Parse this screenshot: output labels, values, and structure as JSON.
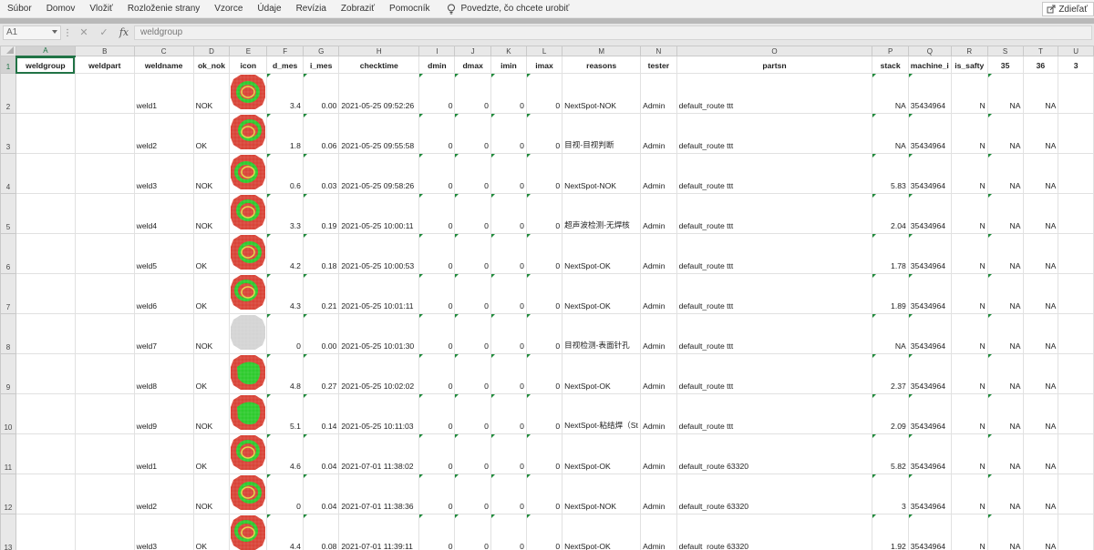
{
  "menu": {
    "items": [
      "Súbor",
      "Domov",
      "Vložiť",
      "Rozloženie strany",
      "Vzorce",
      "Údaje",
      "Revízia",
      "Zobraziť",
      "Pomocník"
    ],
    "tell_me": "Povedzte, čo chcete urobiť",
    "share": "Zdieľať"
  },
  "formula_bar": {
    "name_box": "A1",
    "separator": "⋮",
    "cancel": "✕",
    "enter": "✓",
    "fx": "fx",
    "content": "weldgroup"
  },
  "sheet": {
    "columns": [
      "A",
      "B",
      "C",
      "D",
      "E",
      "F",
      "G",
      "H",
      "I",
      "J",
      "K",
      "L",
      "M",
      "N",
      "O",
      "P",
      "Q",
      "R",
      "S",
      "T",
      "U"
    ],
    "headers": [
      "weldgroup",
      "weldpart",
      "weldname",
      "ok_nok",
      "icon",
      "d_mes",
      "i_mes",
      "checktime",
      "dmin",
      "dmax",
      "imin",
      "imax",
      "reasons",
      "tester",
      "partsn",
      "stack",
      "machine_i",
      "is_safty",
      "35",
      "36",
      "3"
    ],
    "rows": [
      {
        "rownum": "1"
      },
      {
        "rownum": "2",
        "weldname": "weld1",
        "ok_nok": "NOK",
        "icon": "weld-ring",
        "d_mes": "3.4",
        "i_mes": "0.00",
        "checktime": "2021-05-25 09:52:26",
        "dmin": "0",
        "dmax": "0",
        "imin": "0",
        "imax": "0",
        "reasons": "NextSpot-NOK",
        "tester": "Admin",
        "partsn": "default_route ttt",
        "stack": "NA",
        "machine_i": "35434964",
        "is_safty": "N",
        "c35": "NA",
        "c36": "NA"
      },
      {
        "rownum": "3",
        "weldname": "weld2",
        "ok_nok": "OK",
        "icon": "weld-ring",
        "d_mes": "1.8",
        "i_mes": "0.06",
        "checktime": "2021-05-25 09:55:58",
        "dmin": "0",
        "dmax": "0",
        "imin": "0",
        "imax": "0",
        "reasons": "目视-目视判断",
        "tester": "Admin",
        "partsn": "default_route ttt",
        "stack": "NA",
        "machine_i": "35434964",
        "is_safty": "N",
        "c35": "NA",
        "c36": "NA"
      },
      {
        "rownum": "4",
        "weldname": "weld3",
        "ok_nok": "NOK",
        "icon": "weld-ring",
        "d_mes": "0.6",
        "i_mes": "0.03",
        "checktime": "2021-05-25 09:58:26",
        "dmin": "0",
        "dmax": "0",
        "imin": "0",
        "imax": "0",
        "reasons": "NextSpot-NOK",
        "tester": "Admin",
        "partsn": "default_route ttt",
        "stack": "5.83",
        "machine_i": "35434964",
        "is_safty": "N",
        "c35": "NA",
        "c36": "NA"
      },
      {
        "rownum": "5",
        "weldname": "weld4",
        "ok_nok": "NOK",
        "icon": "weld-ring",
        "d_mes": "3.3",
        "i_mes": "0.19",
        "checktime": "2021-05-25 10:00:11",
        "dmin": "0",
        "dmax": "0",
        "imin": "0",
        "imax": "0",
        "reasons": "超声波检测-无焊核",
        "tester": "Admin",
        "partsn": "default_route ttt",
        "stack": "2.04",
        "machine_i": "35434964",
        "is_safty": "N",
        "c35": "NA",
        "c36": "NA"
      },
      {
        "rownum": "6",
        "weldname": "weld5",
        "ok_nok": "OK",
        "icon": "weld-ring",
        "d_mes": "4.2",
        "i_mes": "0.18",
        "checktime": "2021-05-25 10:00:53",
        "dmin": "0",
        "dmax": "0",
        "imin": "0",
        "imax": "0",
        "reasons": "NextSpot-OK",
        "tester": "Admin",
        "partsn": "default_route ttt",
        "stack": "1.78",
        "machine_i": "35434964",
        "is_safty": "N",
        "c35": "NA",
        "c36": "NA"
      },
      {
        "rownum": "7",
        "weldname": "weld6",
        "ok_nok": "OK",
        "icon": "weld-ring",
        "d_mes": "4.3",
        "i_mes": "0.21",
        "checktime": "2021-05-25 10:01:11",
        "dmin": "0",
        "dmax": "0",
        "imin": "0",
        "imax": "0",
        "reasons": "NextSpot-OK",
        "tester": "Admin",
        "partsn": "default_route ttt",
        "stack": "1.89",
        "machine_i": "35434964",
        "is_safty": "N",
        "c35": "NA",
        "c36": "NA"
      },
      {
        "rownum": "8",
        "weldname": "weld7",
        "ok_nok": "NOK",
        "icon": "weld-gray",
        "d_mes": "0",
        "i_mes": "0.00",
        "checktime": "2021-05-25 10:01:30",
        "dmin": "0",
        "dmax": "0",
        "imin": "0",
        "imax": "0",
        "reasons": "目视检测-表面针孔",
        "tester": "Admin",
        "partsn": "default_route ttt",
        "stack": "NA",
        "machine_i": "35434964",
        "is_safty": "N",
        "c35": "NA",
        "c36": "NA"
      },
      {
        "rownum": "9",
        "weldname": "weld8",
        "ok_nok": "OK",
        "icon": "weld-solid",
        "d_mes": "4.8",
        "i_mes": "0.27",
        "checktime": "2021-05-25 10:02:02",
        "dmin": "0",
        "dmax": "0",
        "imin": "0",
        "imax": "0",
        "reasons": "NextSpot-OK",
        "tester": "Admin",
        "partsn": "default_route ttt",
        "stack": "2.37",
        "machine_i": "35434964",
        "is_safty": "N",
        "c35": "NA",
        "c36": "NA"
      },
      {
        "rownum": "10",
        "weldname": "weld9",
        "ok_nok": "NOK",
        "icon": "weld-solid",
        "d_mes": "5.1",
        "i_mes": "0.14",
        "checktime": "2021-05-25 10:11:03",
        "dmin": "0",
        "dmax": "0",
        "imin": "0",
        "imax": "0",
        "reasons": "NextSpot-粘结焊（St",
        "tester": "Admin",
        "partsn": "default_route ttt",
        "stack": "2.09",
        "machine_i": "35434964",
        "is_safty": "N",
        "c35": "NA",
        "c36": "NA"
      },
      {
        "rownum": "11",
        "weldname": "weld1",
        "ok_nok": "OK",
        "icon": "weld-ring",
        "d_mes": "4.6",
        "i_mes": "0.04",
        "checktime": "2021-07-01 11:38:02",
        "dmin": "0",
        "dmax": "0",
        "imin": "0",
        "imax": "0",
        "reasons": "NextSpot-OK",
        "tester": "Admin",
        "partsn": "default_route 63320",
        "stack": "5.82",
        "machine_i": "35434964",
        "is_safty": "N",
        "c35": "NA",
        "c36": "NA"
      },
      {
        "rownum": "12",
        "weldname": "weld2",
        "ok_nok": "NOK",
        "icon": "weld-ring",
        "d_mes": "0",
        "i_mes": "0.04",
        "checktime": "2021-07-01 11:38:36",
        "dmin": "0",
        "dmax": "0",
        "imin": "0",
        "imax": "0",
        "reasons": "NextSpot-NOK",
        "tester": "Admin",
        "partsn": "default_route 63320",
        "stack": "3",
        "machine_i": "35434964",
        "is_safty": "N",
        "c35": "NA",
        "c36": "NA"
      },
      {
        "rownum": "13",
        "weldname": "weld3",
        "ok_nok": "OK",
        "icon": "weld-ring",
        "d_mes": "4.4",
        "i_mes": "0.08",
        "checktime": "2021-07-01 11:39:11",
        "dmin": "0",
        "dmax": "0",
        "imin": "0",
        "imax": "0",
        "reasons": "NextSpot-OK",
        "tester": "Admin",
        "partsn": "default_route 63320",
        "stack": "1.92",
        "machine_i": "35434964",
        "is_safty": "N",
        "c35": "NA",
        "c36": "NA"
      }
    ]
  },
  "colors": {
    "excel_green": "#217346",
    "weld_red": "#d94438",
    "weld_green": "#2ecb2e",
    "weld_yellow": "#e0d84a",
    "weld_gray": "#d4d4d4"
  }
}
